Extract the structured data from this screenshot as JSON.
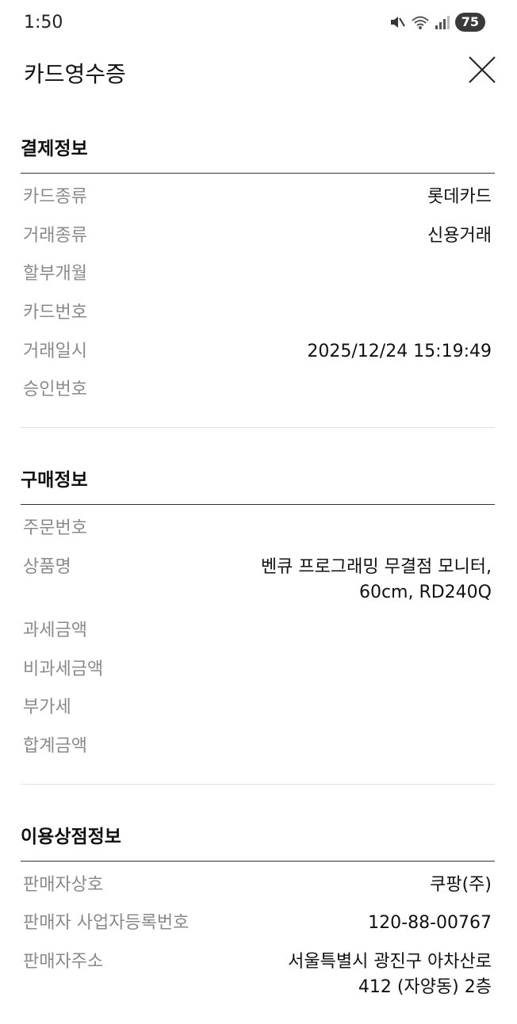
{
  "status_bar": {
    "time": "1:50",
    "battery": "75"
  },
  "header": {
    "title": "카드영수증"
  },
  "sections": [
    {
      "title": "결제정보",
      "rows": [
        {
          "label": "카드종류",
          "value": "롯데카드"
        },
        {
          "label": "거래종류",
          "value": "신용거래"
        },
        {
          "label": "할부개월",
          "value": ""
        },
        {
          "label": "카드번호",
          "value": ""
        },
        {
          "label": "거래일시",
          "value": "2025/12/24 15:19:49"
        },
        {
          "label": "승인번호",
          "value": ""
        }
      ]
    },
    {
      "title": "구매정보",
      "rows": [
        {
          "label": "주문번호",
          "value": ""
        },
        {
          "label": "상품명",
          "value": "벤큐 프로그래밍 무결점 모니터, 60cm, RD240Q"
        },
        {
          "label": "과세금액",
          "value": ""
        },
        {
          "label": "비과세금액",
          "value": ""
        },
        {
          "label": "부가세",
          "value": ""
        },
        {
          "label": "합계금액",
          "value": ""
        }
      ]
    },
    {
      "title": "이용상점정보",
      "rows": [
        {
          "label": "판매자상호",
          "value": "쿠팡(주)"
        },
        {
          "label": "판매자 사업자등록번호",
          "value": "120-88-00767"
        },
        {
          "label": "판매자주소",
          "value": "서울특별시 광진구 아차산로 412 (자양동) 2층"
        }
      ]
    }
  ]
}
